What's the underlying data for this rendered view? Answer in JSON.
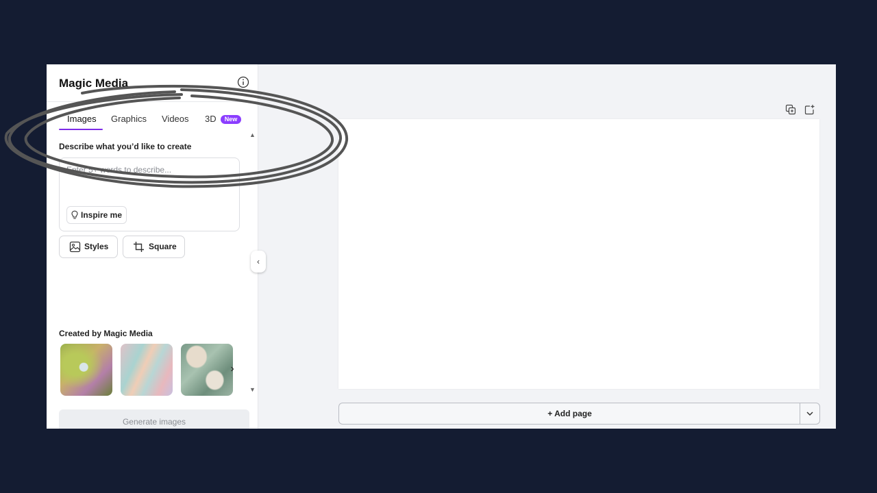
{
  "panel": {
    "title": "Magic Media",
    "tabs": [
      {
        "label": "Images",
        "active": true
      },
      {
        "label": "Graphics",
        "active": false
      },
      {
        "label": "Videos",
        "active": false
      },
      {
        "label": "3D",
        "active": false,
        "badge": "New"
      }
    ],
    "describe_label": "Describe what you’d like to create",
    "prompt": {
      "placeholder": "Enter 5+ words to describe...",
      "value": ""
    },
    "inspire_label": "Inspire me",
    "chips": [
      {
        "label": "Styles",
        "icon": "image-icon"
      },
      {
        "label": "Square",
        "icon": "crop-icon"
      }
    ],
    "created_label": "Created by Magic Media",
    "generate_label": "Generate images"
  },
  "canvas": {
    "add_page_label": "+ Add page",
    "tools": [
      "duplicate-page-icon",
      "add-page-icon"
    ]
  },
  "colors": {
    "background": "#141c32",
    "accent": "#7d2ae8",
    "badge": "#8b3dff",
    "annotation": "#555555"
  }
}
